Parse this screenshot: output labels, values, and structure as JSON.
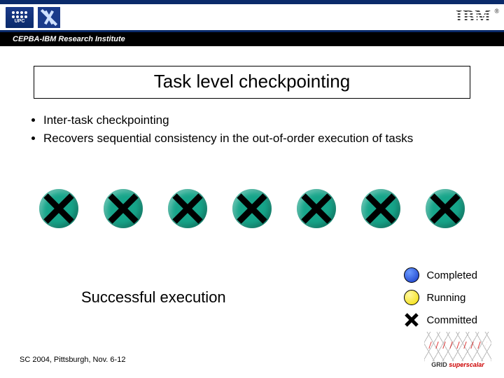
{
  "header": {
    "subtitle": "CEPBA-IBM Research Institute",
    "upc_label": "UPC",
    "ibm_label": "IBM"
  },
  "title": "Task level checkpointing",
  "bullets": [
    "Inter-task checkpointing",
    "Recovers sequential consistency in the out-of-order execution of tasks"
  ],
  "main_label": "Successful execution",
  "legend": {
    "completed": "Completed",
    "running": "Running",
    "committed": "Committed"
  },
  "footer": "SC 2004, Pittsburgh, Nov. 6-12",
  "grid_logo": {
    "prefix": "GRID",
    "suffix": "superscalar"
  }
}
